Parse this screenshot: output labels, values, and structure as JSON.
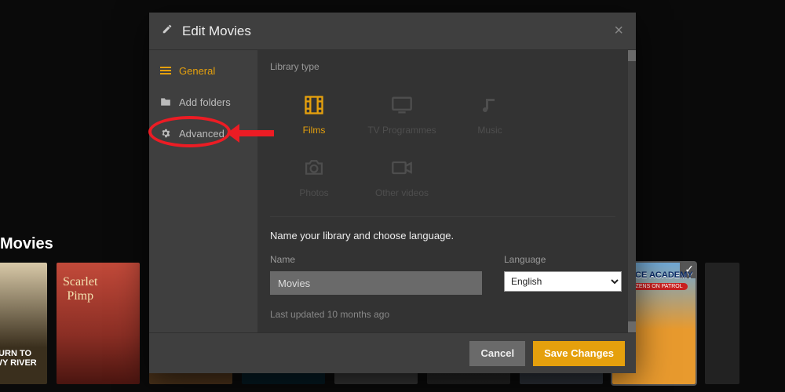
{
  "background": {
    "section_title": "Movies"
  },
  "modal": {
    "title": "Edit Movies",
    "sidebar": {
      "items": [
        {
          "label": "General",
          "icon": "list-icon",
          "active": true
        },
        {
          "label": "Add folders",
          "icon": "folder-icon",
          "active": false
        },
        {
          "label": "Advanced",
          "icon": "gear-icon",
          "active": false
        }
      ]
    },
    "content": {
      "library_type_label": "Library type",
      "types": [
        {
          "label": "Films",
          "selected": true
        },
        {
          "label": "TV Programmes",
          "selected": false
        },
        {
          "label": "Music",
          "selected": false
        },
        {
          "label": "Photos",
          "selected": false
        },
        {
          "label": "Other videos",
          "selected": false
        }
      ],
      "instruction": "Name your library and choose language.",
      "name_field": {
        "label": "Name",
        "value": "Movies"
      },
      "language_field": {
        "label": "Language",
        "value": "English"
      },
      "last_updated": "Last updated 10 months ago"
    },
    "footer": {
      "cancel": "Cancel",
      "save": "Save Changes"
    }
  },
  "colors": {
    "accent": "#e5a00d",
    "annotation": "#ec1c24"
  }
}
